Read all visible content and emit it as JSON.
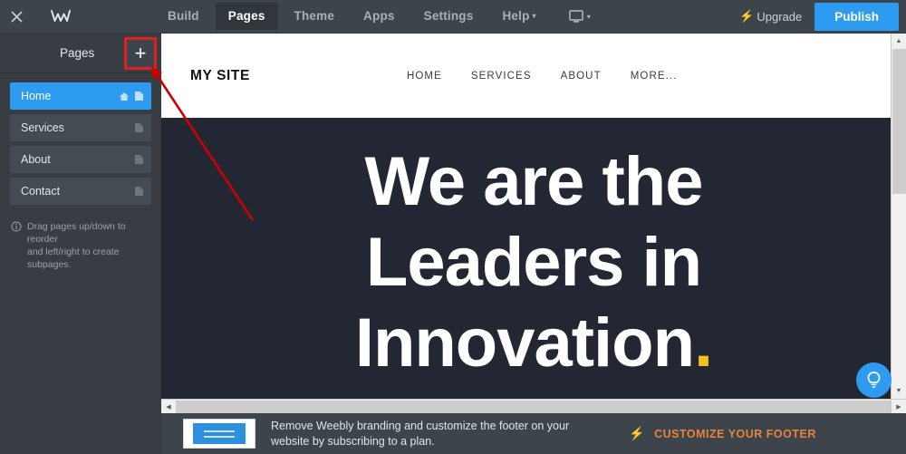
{
  "topbar": {
    "close_icon": "close-icon",
    "logo": "weebly-w-logo",
    "tabs": [
      {
        "label": "Build",
        "active": false
      },
      {
        "label": "Pages",
        "active": true
      },
      {
        "label": "Theme",
        "active": false
      },
      {
        "label": "Apps",
        "active": false
      },
      {
        "label": "Settings",
        "active": false
      },
      {
        "label": "Help",
        "active": false,
        "caret": "▾"
      }
    ],
    "device_icon": "monitor-icon",
    "device_caret": "▾",
    "upgrade_label": "Upgrade",
    "upgrade_icon": "lightning-bolt-icon",
    "publish_label": "Publish"
  },
  "sidebar": {
    "title": "Pages",
    "add_button_label": "+",
    "pages": [
      {
        "label": "Home",
        "active": true,
        "home_icon": true,
        "page_icon": true
      },
      {
        "label": "Services",
        "active": false,
        "home_icon": false,
        "page_icon": true
      },
      {
        "label": "About",
        "active": false,
        "home_icon": false,
        "page_icon": true
      },
      {
        "label": "Contact",
        "active": false,
        "home_icon": false,
        "page_icon": true
      }
    ],
    "hint_line1": "Drag pages up/down to reorder",
    "hint_line2": "and left/right to create subpages.",
    "hint_icon": "info-icon"
  },
  "preview": {
    "site_logo": "MY SITE",
    "nav": [
      "HOME",
      "SERVICES",
      "ABOUT",
      "MORE..."
    ],
    "hero_line1": "We are the",
    "hero_line2": "Leaders  in",
    "hero_line3": "Innovation",
    "hero_dot": ".",
    "bg_color": "#222733",
    "accent_color": "#f2c21a"
  },
  "footer_banner": {
    "text_line1": "Remove Weebly branding and customize the footer on your",
    "text_line2": "website by subscribing to a plan.",
    "cta_label": "CUSTOMIZE YOUR FOOTER",
    "cta_icon": "lightning-bolt-icon",
    "cta_color": "#e8843c",
    "thumbnail": "footer-thumbnail"
  },
  "help": {
    "icon": "lightbulb-icon",
    "color": "#2d9cf0"
  },
  "annotation": {
    "color": "#cc0000",
    "type": "arrow-pointing-to-add-page-button"
  },
  "scrollbars": {
    "vertical": "vertical-scrollbar",
    "horizontal": "horizontal-scrollbar"
  }
}
